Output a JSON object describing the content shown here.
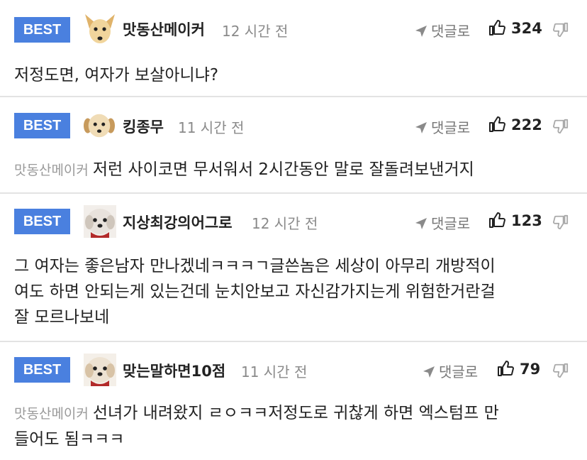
{
  "best_label": "BEST",
  "reply_label": "댓글로",
  "colors": {
    "best_bg": "#4a80df",
    "divider": "#e3e3e3"
  },
  "icons": {
    "reply": "reply-arrow-icon",
    "like": "thumbs-up-icon",
    "dislike": "thumbs-down-icon"
  },
  "comments": [
    {
      "nickname": "맛동산메이커",
      "time": "12 시간 전",
      "likes": "324",
      "reply_to": "",
      "lines": [
        "저정도면, 여자가 보살아니냐?"
      ]
    },
    {
      "nickname": "킹종무",
      "time": "11 시간 전",
      "likes": "222",
      "reply_to": "맛동산메이커",
      "lines": [
        "저런 사이코면 무서워서 2시간동안 말로 잘돌려보낸거지"
      ]
    },
    {
      "nickname": "지상최강의어그로",
      "time": "12 시간 전",
      "likes": "123",
      "reply_to": "",
      "lines": [
        "그 여자는 좋은남자 만나겠네ㅋㅋㅋㄱ글쓴놈은 세상이 아무리 개방적이",
        "여도 하면 안되는게 있는건데 눈치안보고 자신감가지는게 위험한거란걸",
        "잘 모르나보네"
      ]
    },
    {
      "nickname": "맞는말하면10점",
      "time": "11 시간 전",
      "likes": "79",
      "reply_to": "맛동산메이커",
      "lines": [
        "선녀가 내려왔지 ㄹㅇㅋㅋ저정도로 귀찮게 하면 엑스텀프 만",
        "들어도 됨ㅋㅋㅋ"
      ]
    }
  ]
}
